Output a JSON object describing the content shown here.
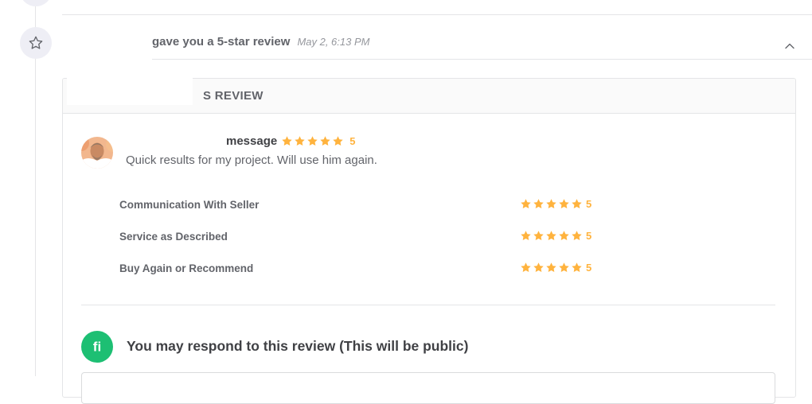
{
  "timeline": {
    "event_icon": "star-outline-icon",
    "event_text": "gave you a 5-star review",
    "event_time": "May 2, 6:13 PM",
    "collapse_icon": "chevron-up-icon"
  },
  "review_card": {
    "title": "S REVIEW",
    "reviewer_message": "message",
    "overall_rating": "5",
    "overall_rating_value": 5,
    "review_text": "Quick results for my project. Will use him again.",
    "criteria": [
      {
        "label": "Communication With Seller",
        "rating": "5",
        "rating_value": 5
      },
      {
        "label": "Service as Described",
        "rating": "5",
        "rating_value": 5
      },
      {
        "label": "Buy Again or Recommend",
        "rating": "5",
        "rating_value": 5
      }
    ]
  },
  "respond": {
    "logo_icon": "fiverr-logo-icon",
    "title": "You may respond to this review (This will be public)"
  },
  "colors": {
    "star": "#ffb33e",
    "brand_green": "#1dbf73",
    "text_dark": "#404145",
    "text_muted": "#62646a",
    "border": "#e4e5e7"
  }
}
